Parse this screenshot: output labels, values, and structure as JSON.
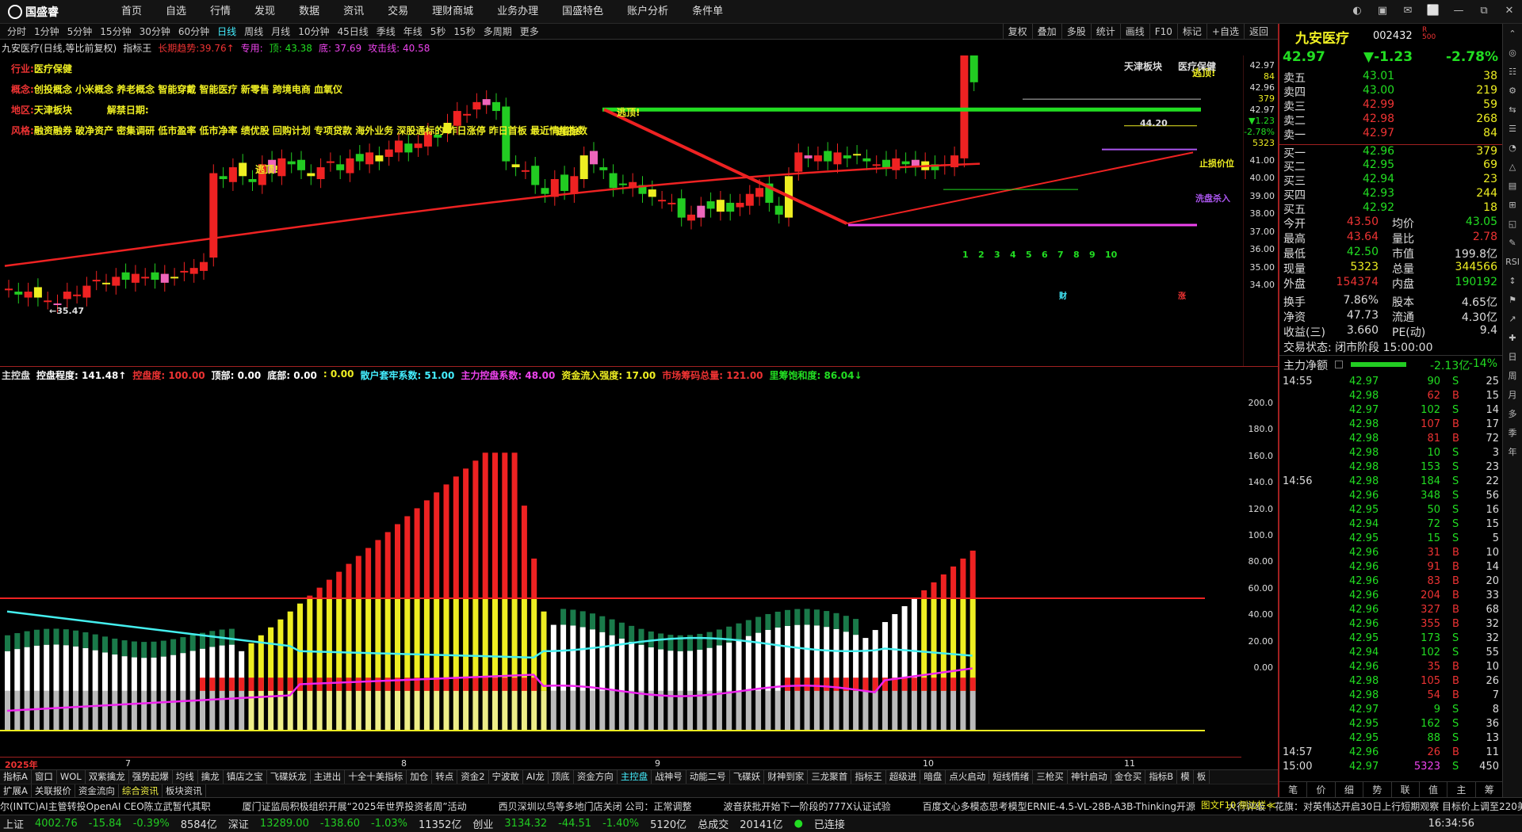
{
  "brand": "国盛睿",
  "menus": [
    "首页",
    "自选",
    "行情",
    "发现",
    "数据",
    "资讯",
    "交易",
    "理财商城",
    "业务办理",
    "国盛特色",
    "账户分析",
    "条件单"
  ],
  "window_controls": [
    "◐",
    "▣",
    "✉",
    "⬜",
    "—",
    "⧉",
    "✕"
  ],
  "periods": [
    "分时",
    "1分钟",
    "5分钟",
    "15分钟",
    "30分钟",
    "60分钟",
    "日线",
    "周线",
    "月线",
    "10分钟",
    "45日线",
    "季线",
    "年线",
    "5秒",
    "15秒",
    "多周期",
    "更多"
  ],
  "active_period": "日线",
  "tools": [
    "复权",
    "叠加",
    "多股",
    "统计",
    "画线",
    "F10",
    "标记",
    "+自选",
    "返回"
  ],
  "kinfo": {
    "name": "九安医疗(日线,等比前复权)",
    "indicator": "指标王",
    "trend_label": "长期趋势:",
    "trend_val": "39.76↑",
    "zy": "专用:",
    "top": "顶: 43.38",
    "bottom": "底: 37.69",
    "attack": "攻击线: 40.58"
  },
  "labels": {
    "industry_k": "行业:",
    "industry_v": "医疗保健",
    "concept_k": "概念:",
    "concept_v": "创投概念 小米概念 养老概念 智能穿戴 智能医疗 新零售 跨境电商 血氧仪",
    "region_k": "地区:",
    "region_v": "天津板块",
    "unlock": "解禁日期:",
    "style_k": "风格:",
    "style_v": "融资融券 破净资产 密集调研 低市盈率 低市净率 绩优股 回购计划 专项贷款 海外业务 深股通标的 昨日涨停 昨日首板 最近情绪指数"
  },
  "chart_marks": {
    "escape1": "逃顶!",
    "escape2": "逃顶!",
    "escape3": "逃顶!",
    "escape4": "逃顶!",
    "low": "←35.47",
    "high": "44.20",
    "stop": "止损价位",
    "wash": "洗盘杀入",
    "tianjin": "天津板块",
    "medical": "医疗保健",
    "seq": [
      "1",
      "2",
      "3",
      "4",
      "5",
      "6",
      "7",
      "8",
      "9",
      "10"
    ],
    "finance": "财",
    "rise": "涨"
  },
  "k_axis": [
    "42.97",
    "84",
    "42.96",
    "379",
    "42.97",
    "▼1.23",
    "-2.78%",
    "5323",
    "41.00",
    "40.00",
    "39.00",
    "38.00",
    "37.00",
    "36.00",
    "35.00",
    "34.00"
  ],
  "ind_header": {
    "name": "主控盘",
    "ctrl": "控盘程度: 141.48↑",
    "hot": "控盘度: 100.00",
    "top": "顶部: 0.00",
    "bottom": "底部: 0.00",
    "zero": ": 0.00",
    "retail": "散户套牢系数: 51.00",
    "main": "主力控盘系数: 48.00",
    "inflow": "资金流入强度: 17.00",
    "chips": "市场筹码总量: 121.00",
    "saturation": "里筹饱和度: 86.04↓"
  },
  "ind_axis": [
    "200.0",
    "180.0",
    "160.0",
    "140.0",
    "120.0",
    "100.0",
    "80.00",
    "60.00",
    "40.00",
    "20.00",
    "0.00"
  ],
  "date_axis": {
    "year": "2025年",
    "m7": "7",
    "m8": "8",
    "m9": "9",
    "m10": "10",
    "m11": "11"
  },
  "tabs1": [
    "指标A",
    "窗口",
    "WOL",
    "双紫擒龙",
    "强势起爆",
    "均线",
    "擒龙",
    "镇店之宝",
    "飞碟妖龙",
    "主进出",
    "十全十美指标",
    "加仓",
    "转点",
    "资金2",
    "宁波敢",
    "AI龙",
    "顶底",
    "资金方向",
    "主控盘",
    "战神号",
    "动能二号",
    "飞碟妖",
    "财神到家",
    "三龙聚首",
    "指标王",
    "超级进",
    "暗盘",
    "点火启动",
    "短线情绪",
    "三枪买",
    "神针启动",
    "金仓买",
    "指标B",
    "模",
    "板"
  ],
  "active_tab1": "主控盘",
  "tabs2": [
    "扩展A",
    "关联报价",
    "资金流向",
    "综合资讯",
    "板块资讯"
  ],
  "active_tab2": "综合资讯",
  "news": [
    "尔(INTC)AI主管转投OpenAI CEO陈立武暂代其职",
    "厦门证监局积极组织开展“2025年世界投资者周”活动",
    "西贝深圳以鸟等多地门店关闭 公司：正常调整",
    "波音获批开始下一阶段的777X认证试验",
    "百度文心多模态思考模型ERNIE-4.5-VL-28B-A3B-Thinking开源",
    "大行评级｜花旗：对英伟达开启30日上行短期观察 目标价上调至220美"
  ],
  "status": {
    "sh": "上证",
    "sh_v": "4002.76",
    "sh_c": "-15.84",
    "sh_p": "-0.39%",
    "sh_a": "8584亿",
    "sz": "深证",
    "sz_v": "13289.00",
    "sz_c": "-138.60",
    "sz_p": "-1.03%",
    "sz_a": "11352亿",
    "cy": "创业",
    "cy_v": "3134.32",
    "cy_c": "-44.51",
    "cy_p": "-1.40%",
    "cy_a": "5120亿",
    "total": "总成交",
    "total_v": "20141亿",
    "conn": "已连接",
    "time": "16:34:56",
    "f10": "图文F10 侧边栏≪"
  },
  "stock": {
    "name": "九安医疗",
    "code": "002432",
    "badge1": "R",
    "badge2": "500",
    "price": "42.97",
    "change": "▼-1.23",
    "pct": "-2.78%"
  },
  "book": [
    {
      "n": "卖五",
      "p": "43.01",
      "v": "38"
    },
    {
      "n": "卖四",
      "p": "43.00",
      "v": "219"
    },
    {
      "n": "卖三",
      "p": "42.99",
      "v": "59"
    },
    {
      "n": "卖二",
      "p": "42.98",
      "v": "268"
    },
    {
      "n": "卖一",
      "p": "42.97",
      "v": "84"
    },
    {
      "n": "买一",
      "p": "42.96",
      "v": "379"
    },
    {
      "n": "买二",
      "p": "42.95",
      "v": "69"
    },
    {
      "n": "买三",
      "p": "42.94",
      "v": "23"
    },
    {
      "n": "买四",
      "p": "42.93",
      "v": "244"
    },
    {
      "n": "买五",
      "p": "42.92",
      "v": "18"
    }
  ],
  "stats": [
    {
      "a": "今开",
      "av": "43.50",
      "b": "均价",
      "bv": "43.05"
    },
    {
      "a": "最高",
      "av": "43.64",
      "b": "量比",
      "bv": "2.78"
    },
    {
      "a": "最低",
      "av": "42.50",
      "b": "市值",
      "bv": "199.8亿"
    },
    {
      "a": "现量",
      "av": "5323",
      "b": "总量",
      "bv": "344566"
    },
    {
      "a": "外盘",
      "av": "154374",
      "b": "内盘",
      "bv": "190192"
    },
    {
      "a": "换手",
      "av": "7.86%",
      "b": "股本",
      "bv": "4.65亿"
    },
    {
      "a": "净资",
      "av": "47.73",
      "b": "流通",
      "bv": "4.30亿"
    },
    {
      "a": "收益(三)",
      "av": "3.660",
      "b": "PE(动)",
      "bv": "9.4"
    }
  ],
  "trade_state": "交易状态: 闭市阶段 15:00:00",
  "main_flow": {
    "label": "主力净额",
    "val": "-2.13亿",
    "pct": "-14%"
  },
  "ticks": [
    {
      "t": "14:55",
      "p": "42.97",
      "v": "90",
      "bs": "S",
      "n": "25"
    },
    {
      "t": "",
      "p": "42.98",
      "v": "62",
      "bs": "B",
      "n": "15"
    },
    {
      "t": "",
      "p": "42.97",
      "v": "102",
      "bs": "S",
      "n": "14"
    },
    {
      "t": "",
      "p": "42.98",
      "v": "107",
      "bs": "B",
      "n": "17"
    },
    {
      "t": "",
      "p": "42.98",
      "v": "81",
      "bs": "B",
      "n": "72"
    },
    {
      "t": "",
      "p": "42.98",
      "v": "10",
      "bs": "S",
      "n": "3"
    },
    {
      "t": "",
      "p": "42.98",
      "v": "153",
      "bs": "S",
      "n": "23"
    },
    {
      "t": "14:56",
      "p": "42.98",
      "v": "184",
      "bs": "S",
      "n": "22"
    },
    {
      "t": "",
      "p": "42.96",
      "v": "348",
      "bs": "S",
      "n": "56"
    },
    {
      "t": "",
      "p": "42.95",
      "v": "50",
      "bs": "S",
      "n": "16"
    },
    {
      "t": "",
      "p": "42.94",
      "v": "72",
      "bs": "S",
      "n": "15"
    },
    {
      "t": "",
      "p": "42.95",
      "v": "15",
      "bs": "S",
      "n": "5"
    },
    {
      "t": "",
      "p": "42.96",
      "v": "31",
      "bs": "B",
      "n": "10"
    },
    {
      "t": "",
      "p": "42.96",
      "v": "91",
      "bs": "B",
      "n": "14"
    },
    {
      "t": "",
      "p": "42.96",
      "v": "83",
      "bs": "B",
      "n": "20"
    },
    {
      "t": "",
      "p": "42.96",
      "v": "204",
      "bs": "B",
      "n": "33"
    },
    {
      "t": "",
      "p": "42.96",
      "v": "327",
      "bs": "B",
      "n": "68"
    },
    {
      "t": "",
      "p": "42.96",
      "v": "355",
      "bs": "B",
      "n": "32"
    },
    {
      "t": "",
      "p": "42.95",
      "v": "173",
      "bs": "S",
      "n": "32"
    },
    {
      "t": "",
      "p": "42.94",
      "v": "102",
      "bs": "S",
      "n": "55"
    },
    {
      "t": "",
      "p": "42.96",
      "v": "35",
      "bs": "B",
      "n": "10"
    },
    {
      "t": "",
      "p": "42.98",
      "v": "105",
      "bs": "B",
      "n": "26"
    },
    {
      "t": "",
      "p": "42.98",
      "v": "54",
      "bs": "B",
      "n": "7"
    },
    {
      "t": "",
      "p": "42.97",
      "v": "9",
      "bs": "S",
      "n": "8"
    },
    {
      "t": "",
      "p": "42.95",
      "v": "162",
      "bs": "S",
      "n": "36"
    },
    {
      "t": "",
      "p": "42.95",
      "v": "88",
      "bs": "S",
      "n": "13"
    },
    {
      "t": "14:57",
      "p": "42.96",
      "v": "26",
      "bs": "B",
      "n": "11"
    },
    {
      "t": "15:00",
      "p": "42.97",
      "v": "5323",
      "bs": "S",
      "n": "450"
    }
  ],
  "right_tabs": [
    "笔",
    "价",
    "细",
    "势",
    "联",
    "值",
    "主",
    "筹"
  ],
  "sidebar": [
    "⌃",
    "◎",
    "☷",
    "⚙",
    "⇆",
    "☰",
    "◔",
    "△",
    "▤",
    "⊞",
    "◱",
    "✎",
    "RSI",
    "↕",
    "⚑",
    "↗",
    "✚",
    "日",
    "周",
    "月",
    "多",
    "季",
    "年"
  ],
  "colors": {
    "up": "#ee2222",
    "down": "#22cc22",
    "yellow": "#eeee22",
    "accent": "#44eeff"
  }
}
